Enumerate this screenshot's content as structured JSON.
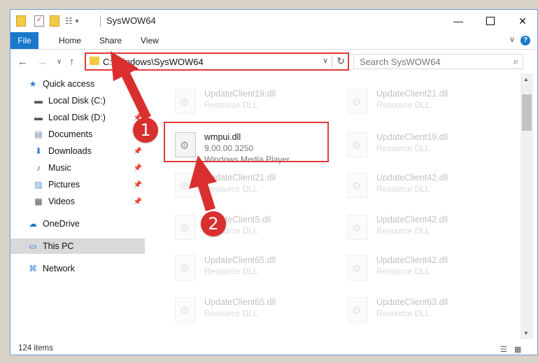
{
  "window": {
    "title": "SysWOW64"
  },
  "ribbon": {
    "tabs": [
      "File",
      "Home",
      "Share",
      "View"
    ]
  },
  "nav": {
    "address": "C:\\Windows\\SysWOW64",
    "search_placeholder": "Search SysWOW64"
  },
  "sidebar": {
    "items": [
      {
        "label": "Quick access",
        "icon": "star-icon",
        "pinned": false
      },
      {
        "label": "Local Disk (C:)",
        "icon": "drive-icon",
        "pinned": true
      },
      {
        "label": "Local Disk (D:)",
        "icon": "drive-icon",
        "pinned": true
      },
      {
        "label": "Documents",
        "icon": "documents-icon",
        "pinned": true
      },
      {
        "label": "Downloads",
        "icon": "download-icon",
        "pinned": true
      },
      {
        "label": "Music",
        "icon": "music-icon",
        "pinned": true
      },
      {
        "label": "Pictures",
        "icon": "pictures-icon",
        "pinned": true
      },
      {
        "label": "Videos",
        "icon": "videos-icon",
        "pinned": true
      },
      {
        "label": "OneDrive",
        "icon": "cloud-icon",
        "pinned": false
      },
      {
        "label": "This PC",
        "icon": "computer-icon",
        "pinned": false,
        "active": true
      },
      {
        "label": "Network",
        "icon": "network-icon",
        "pinned": false
      }
    ]
  },
  "files": {
    "col1": [
      {
        "name": "UpdateClient19.dll",
        "desc": "Resource DLL"
      },
      {
        "name": "wmpui.dll",
        "desc": "9.00.00.3250",
        "desc2": "Windows Media Player"
      },
      {
        "name": "UpdateClient21.dll",
        "desc": "Resource DLL"
      },
      {
        "name": "UpdateClient5.dll",
        "desc": "Resource DLL"
      },
      {
        "name": "UpdateClient65.dll",
        "desc": "Resource DLL"
      },
      {
        "name": "UpdateClient65.dll",
        "desc": "Resource DLL"
      }
    ],
    "col2": [
      {
        "name": "UpdateClient21.dll",
        "desc": "Resource DLL"
      },
      {
        "name": "UpdateClient19.dll",
        "desc": "Resource DLL"
      },
      {
        "name": "UpdateClient42.dll",
        "desc": "Resource DLL"
      },
      {
        "name": "UpdateClient42.dll",
        "desc": "Resource DLL"
      },
      {
        "name": "UpdateClient42.dll",
        "desc": "Resource DLL"
      },
      {
        "name": "UpdateClient63.dll",
        "desc": "Resource DLL"
      }
    ]
  },
  "status": {
    "item_count": "124 items"
  },
  "annotations": {
    "step1": "1",
    "step2": "2"
  },
  "colors": {
    "accent": "#1979ca",
    "annotation": "#d92f2f"
  }
}
